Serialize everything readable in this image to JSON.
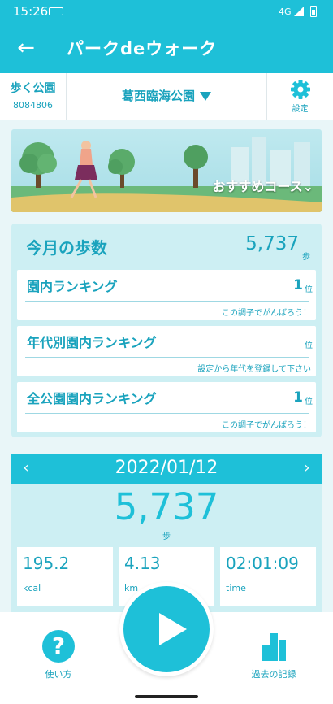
{
  "status_bar": {
    "time": "15:26",
    "network": "4G"
  },
  "app_bar": {
    "title": "パークdeウォーク"
  },
  "park_bar": {
    "walk_park_label": "歩く公園",
    "walk_park_id": "8084806",
    "park_name": "葛西臨海公園",
    "settings_label": "設定"
  },
  "banner": {
    "label": "おすすめコース⌄"
  },
  "monthly": {
    "title": "今月の歩数",
    "steps": "5,737",
    "unit": "歩",
    "rankings": [
      {
        "label": "園内ランキング",
        "value": "1",
        "unit": "位",
        "message": "この調子でがんばろう！"
      },
      {
        "label": "年代別園内ランキング",
        "value": "",
        "unit": "位",
        "message": "設定から年代を登録して下さい"
      },
      {
        "label": "全公園園内ランキング",
        "value": "1",
        "unit": "位",
        "message": "この調子でがんばろう！"
      }
    ]
  },
  "daily": {
    "prev": "‹",
    "next": "›",
    "date": "2022/01/12",
    "steps": "5,737",
    "unit": "歩",
    "metrics": [
      {
        "value": "195.2",
        "label": "kcal"
      },
      {
        "value": "4.13",
        "label": "km"
      },
      {
        "value": "02:01:09",
        "label": "time"
      }
    ]
  },
  "bottom_nav": {
    "help_label": "使い方",
    "history_label": "過去の記録",
    "help_icon": "?"
  },
  "colors": {
    "primary": "#1ec0d8",
    "text_accent": "#1aa3bd",
    "card_bg": "#cdeff3",
    "page_bg": "#e9f6f8"
  },
  "icons": [
    "back-arrow-icon",
    "caret-down-icon",
    "gear-icon",
    "help-icon",
    "play-icon",
    "bar-chart-icon"
  ]
}
